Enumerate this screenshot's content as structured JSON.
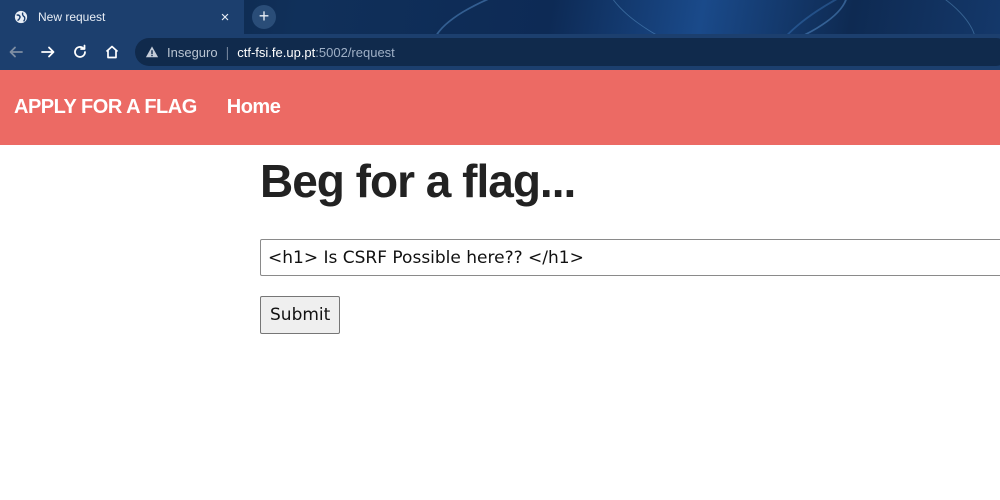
{
  "browser": {
    "tab_title": "New request",
    "close_symbol": "×",
    "new_tab_symbol": "+",
    "insecure_label": "Inseguro",
    "url_host": "ctf-fsi.fe.up.pt",
    "url_path": ":5002/request",
    "icons": [
      "globe-icon",
      "close-icon",
      "plus-icon",
      "back-arrow-icon",
      "forward-arrow-icon",
      "reload-icon",
      "home-icon",
      "warning-icon"
    ]
  },
  "navbar": {
    "brand": "APPLY FOR A FLAG",
    "links": [
      "Home"
    ],
    "color": "#ec6a64"
  },
  "main": {
    "heading": "Beg for a flag...",
    "input_value": "<h1> Is CSRF Possible here?? </h1>",
    "submit_label": "Submit"
  }
}
